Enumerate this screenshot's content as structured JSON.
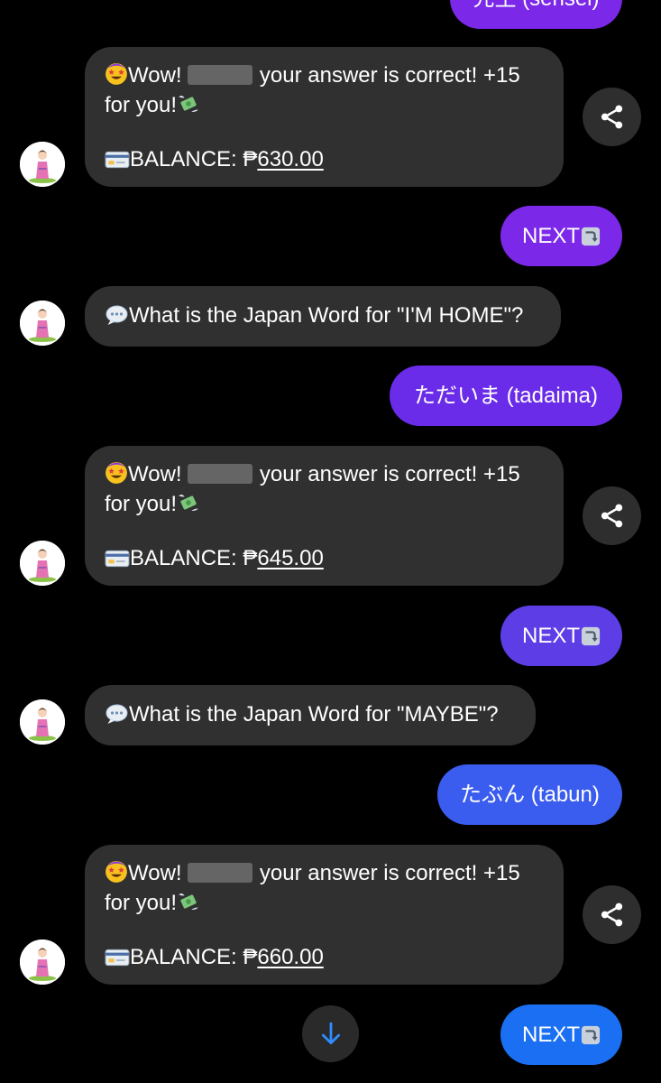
{
  "colors": {
    "background": "#000000",
    "incoming_bubble": "#303030",
    "outgoing_purple": "#7b28e8",
    "outgoing_violet": "#5d3ee6",
    "outgoing_blue": "#3a5cef",
    "outgoing_bright_blue": "#1a6ff2",
    "scroll_arrow": "#2f8dff"
  },
  "top_partial": {
    "text": "先生 (sensei)"
  },
  "messages": [
    {
      "line1_prefix": "Wow! ",
      "line1_suffix": " your answer is correct! +15",
      "line2": "for you!",
      "balance_label": "BALANCE: ₱",
      "balance_amount": "630.00"
    },
    {
      "next_label": "NEXT"
    },
    {
      "question": "What is the Japan Word for \"I'M HOME\"?"
    },
    {
      "answer": "ただいま (tadaima)"
    },
    {
      "line1_prefix": "Wow! ",
      "line1_suffix": " your answer is correct! +15",
      "line2": "for you!",
      "balance_label": "BALANCE: ₱",
      "balance_amount": "645.00"
    },
    {
      "next_label": "NEXT"
    },
    {
      "question": "What is the Japan Word for \"MAYBE\"?"
    },
    {
      "answer": "たぶん (tabun)"
    },
    {
      "line1_prefix": "Wow! ",
      "line1_suffix": " your answer is correct! +15",
      "line2": "for you!",
      "balance_label": "BALANCE: ₱",
      "balance_amount": "660.00"
    },
    {
      "next_label": "NEXT"
    }
  ],
  "icons": {
    "star_struck": "star-struck-emoji",
    "money_wings": "money-with-wings-emoji",
    "credit_card": "credit-card-emoji",
    "speech": "speech-balloon-emoji",
    "next_arrow": "right-arrow-curving-down-emoji",
    "share": "share-icon",
    "scroll_down": "arrow-down-icon"
  }
}
